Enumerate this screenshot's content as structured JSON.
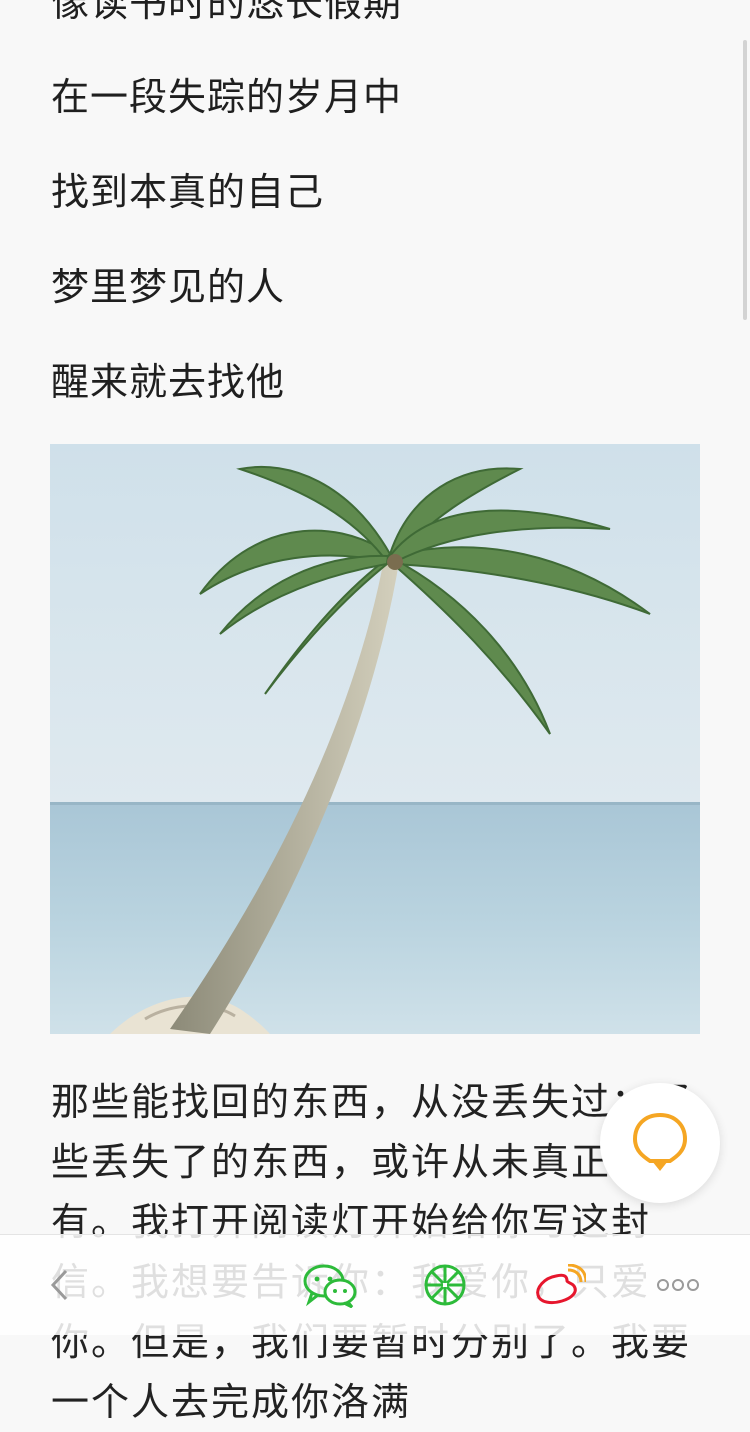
{
  "article": {
    "lines": [
      "像读书时的悠长假期",
      "在一段失踪的岁月中",
      "找到本真的自己",
      "梦里梦见的人",
      "醒来就去找他"
    ],
    "paragraph": "那些能找回的东西，从没丢失过；那些丢失了的东西，或许从未真正拥有。我打开阅读灯开始给你写这封信。我想要告诉你：我爱你，只爱你。但是，我们要暂时分别了。我要一个人去完成你洛满"
  },
  "photo": {
    "icon": "palm-tree-beach-image"
  },
  "reading_light": {
    "icon": "lightbulb-icon",
    "color": "#f5a623"
  },
  "bottom_bar": {
    "icons": [
      "back-icon",
      "wechat-icon",
      "moments-icon",
      "weibo-icon",
      "more-icon"
    ],
    "colors": {
      "wechat": "#2dbb3a",
      "weibo": "#e6162d",
      "gray": "#9a9a9a"
    }
  }
}
